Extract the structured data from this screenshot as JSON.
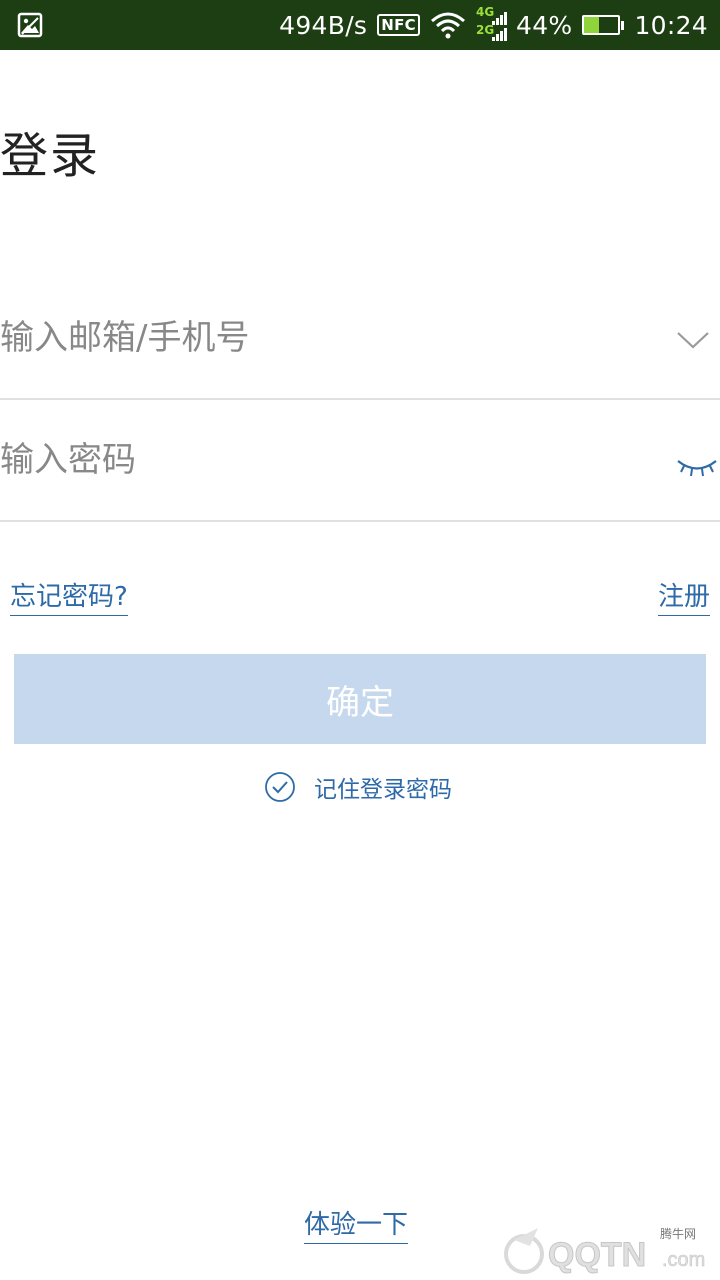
{
  "status_bar": {
    "net_speed": "494B/s",
    "nfc_label": "NFC",
    "net_4g": "4G",
    "net_2g": "2G",
    "battery_percent": "44%",
    "battery_level": 0.44,
    "time": "10:24",
    "background_color": "#1d3d13"
  },
  "page": {
    "title": "登录"
  },
  "account_field": {
    "placeholder": "输入邮箱/手机号",
    "value": "",
    "dropdown_icon": "chevron-down-icon"
  },
  "password_field": {
    "placeholder": "输入密码",
    "value": "",
    "visibility_icon": "eye-closed-icon"
  },
  "links": {
    "forgot_password": "忘记密码?",
    "register": "注册",
    "try_it": "体验一下"
  },
  "confirm_button": {
    "label": "确定",
    "background_color": "#c5d8ed"
  },
  "remember": {
    "label": "记住登录密码",
    "checked": true,
    "icon": "check-circle-icon"
  },
  "watermark": {
    "brand": "QQTN.com",
    "caption": "腾牛网"
  },
  "colors": {
    "accent": "#2e6aa8",
    "divider": "#e0e0e0"
  }
}
